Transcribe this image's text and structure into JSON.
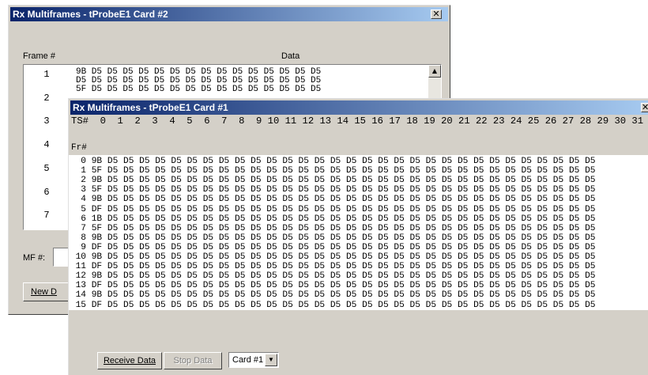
{
  "back_window": {
    "title": "Rx Multiframes - tProbeE1 Card #2",
    "close_glyph": "✕",
    "frame_col_label": "Frame #",
    "data_col_label": "Data",
    "frame_numbers": [
      "1",
      "2",
      "3",
      "4",
      "5",
      "6",
      "7"
    ],
    "frame1_line1": "9B D5 D5 D5 D5 D5 D5 D5 D5 D5 D5 D5 D5 D5 D5 D5",
    "frame1_line2": "D5 D5 D5 D5 D5 D5 D5 D5 D5 D5 D5 D5 D5 D5 D5 D5",
    "frame2_line1": "5F D5 D5 D5 D5 D5 D5 D5 D5 D5 D5 D5 D5 D5 D5 D5",
    "mf_label": "MF #:",
    "new_data_button": "New D"
  },
  "front_window": {
    "title": "Rx Multiframes - tProbeE1 Card #1",
    "close_glyph": "✕",
    "ts_header": "TS#  0  1  2  3  4  5  6  7  8  9 10 11 12 13 14 15 16 17 18 19 20 21 22 23 24 25 26 27 28 29 30 31",
    "fr_label": "Fr#",
    "rows": [
      {
        "idx": "0",
        "data": "9B D5 D5 D5 D5 D5 D5 D5 D5 D5 D5 D5 D5 D5 D5 D5 D5 D5 D5 D5 D5 D5 D5 D5 D5 D5 D5 D5 D5 D5 D5 D5"
      },
      {
        "idx": "1",
        "data": "5F D5 D5 D5 D5 D5 D5 D5 D5 D5 D5 D5 D5 D5 D5 D5 D5 D5 D5 D5 D5 D5 D5 D5 D5 D5 D5 D5 D5 D5 D5 D5"
      },
      {
        "idx": "2",
        "data": "9B D5 D5 D5 D5 D5 D5 D5 D5 D5 D5 D5 D5 D5 D5 D5 D5 D5 D5 D5 D5 D5 D5 D5 D5 D5 D5 D5 D5 D5 D5 D5"
      },
      {
        "idx": "3",
        "data": "5F D5 D5 D5 D5 D5 D5 D5 D5 D5 D5 D5 D5 D5 D5 D5 D5 D5 D5 D5 D5 D5 D5 D5 D5 D5 D5 D5 D5 D5 D5 D5"
      },
      {
        "idx": "4",
        "data": "9B D5 D5 D5 D5 D5 D5 D5 D5 D5 D5 D5 D5 D5 D5 D5 D5 D5 D5 D5 D5 D5 D5 D5 D5 D5 D5 D5 D5 D5 D5 D5"
      },
      {
        "idx": "5",
        "data": "DF D5 D5 D5 D5 D5 D5 D5 D5 D5 D5 D5 D5 D5 D5 D5 D5 D5 D5 D5 D5 D5 D5 D5 D5 D5 D5 D5 D5 D5 D5 D5"
      },
      {
        "idx": "6",
        "data": "1B D5 D5 D5 D5 D5 D5 D5 D5 D5 D5 D5 D5 D5 D5 D5 D5 D5 D5 D5 D5 D5 D5 D5 D5 D5 D5 D5 D5 D5 D5 D5"
      },
      {
        "idx": "7",
        "data": "5F D5 D5 D5 D5 D5 D5 D5 D5 D5 D5 D5 D5 D5 D5 D5 D5 D5 D5 D5 D5 D5 D5 D5 D5 D5 D5 D5 D5 D5 D5 D5"
      },
      {
        "idx": "8",
        "data": "9B D5 D5 D5 D5 D5 D5 D5 D5 D5 D5 D5 D5 D5 D5 D5 D5 D5 D5 D5 D5 D5 D5 D5 D5 D5 D5 D5 D5 D5 D5 D5"
      },
      {
        "idx": "9",
        "data": "DF D5 D5 D5 D5 D5 D5 D5 D5 D5 D5 D5 D5 D5 D5 D5 D5 D5 D5 D5 D5 D5 D5 D5 D5 D5 D5 D5 D5 D5 D5 D5"
      },
      {
        "idx": "10",
        "data": "9B D5 D5 D5 D5 D5 D5 D5 D5 D5 D5 D5 D5 D5 D5 D5 D5 D5 D5 D5 D5 D5 D5 D5 D5 D5 D5 D5 D5 D5 D5 D5"
      },
      {
        "idx": "11",
        "data": "DF D5 D5 D5 D5 D5 D5 D5 D5 D5 D5 D5 D5 D5 D5 D5 D5 D5 D5 D5 D5 D5 D5 D5 D5 D5 D5 D5 D5 D5 D5 D5"
      },
      {
        "idx": "12",
        "data": "9B D5 D5 D5 D5 D5 D5 D5 D5 D5 D5 D5 D5 D5 D5 D5 D5 D5 D5 D5 D5 D5 D5 D5 D5 D5 D5 D5 D5 D5 D5 D5"
      },
      {
        "idx": "13",
        "data": "DF D5 D5 D5 D5 D5 D5 D5 D5 D5 D5 D5 D5 D5 D5 D5 D5 D5 D5 D5 D5 D5 D5 D5 D5 D5 D5 D5 D5 D5 D5 D5"
      },
      {
        "idx": "14",
        "data": "9B D5 D5 D5 D5 D5 D5 D5 D5 D5 D5 D5 D5 D5 D5 D5 D5 D5 D5 D5 D5 D5 D5 D5 D5 D5 D5 D5 D5 D5 D5 D5"
      },
      {
        "idx": "15",
        "data": "DF D5 D5 D5 D5 D5 D5 D5 D5 D5 D5 D5 D5 D5 D5 D5 D5 D5 D5 D5 D5 D5 D5 D5 D5 D5 D5 D5 D5 D5 D5 D5"
      }
    ],
    "receive_button": "Receive Data",
    "stop_button": "Stop Data",
    "card_select": "Card #1"
  }
}
